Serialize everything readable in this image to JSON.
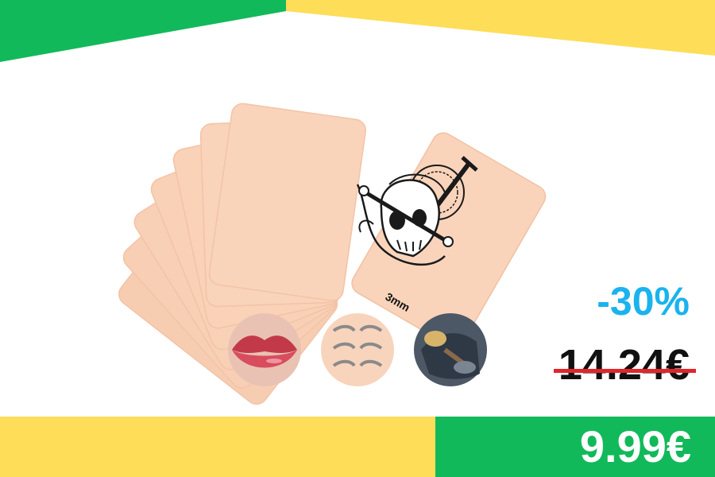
{
  "product": {
    "thickness_label": "3mm",
    "discount_label": "-30%",
    "old_price": "14.24€",
    "new_price": "9.99€"
  },
  "thumbnails": [
    {
      "icon": "lips-icon"
    },
    {
      "icon": "eyebrows-icon"
    },
    {
      "icon": "tattoo-machine-icon"
    }
  ],
  "colors": {
    "green": "#12b95a",
    "yellow": "#fedd58",
    "skin": "#f9d4bb",
    "discount": "#1ab3ee",
    "strike": "#e0262b"
  }
}
